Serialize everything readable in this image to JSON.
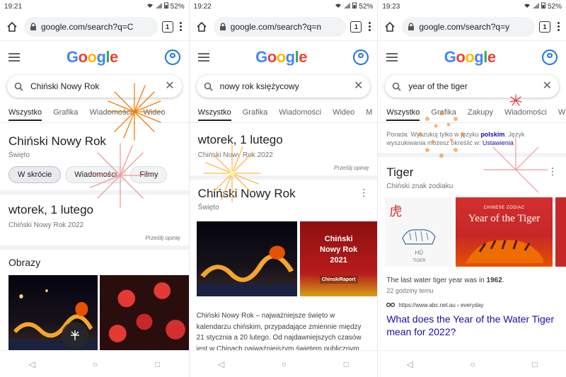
{
  "panels": [
    {
      "status": {
        "time": "19:21",
        "battery": "52%"
      },
      "browser": {
        "url": "google.com/search?q=C",
        "tab_count": "1"
      },
      "search": {
        "query": "Chiński Nowy Rok"
      },
      "tabs": [
        "Wszystko",
        "Grafika",
        "Wiadomości",
        "Wideo"
      ],
      "knowledge": {
        "title": "Chiński Nowy Rok",
        "subtitle": "Święto",
        "chips": [
          "W skrócie",
          "Wiadomości",
          "Filmy"
        ]
      },
      "date": {
        "title": "wtorek, 1 lutego",
        "subtitle": "Chiński Nowy Rok 2022"
      },
      "feedback": "Prześlij opinię",
      "images_heading": "Obrazy"
    },
    {
      "status": {
        "time": "19:22",
        "battery": "52%"
      },
      "browser": {
        "url": "google.com/search?q=n",
        "tab_count": "1"
      },
      "search": {
        "query": "nowy rok księżycowy"
      },
      "tabs": [
        "Wszystko",
        "Grafika",
        "Wiadomości",
        "Wideo",
        "M"
      ],
      "date": {
        "title": "wtorek, 1 lutego",
        "subtitle": "Chiński Nowy Rok 2022"
      },
      "feedback": "Prześlij opinię",
      "knowledge": {
        "title": "Chiński Nowy Rok",
        "subtitle": "Święto"
      },
      "image_card": {
        "line1": "Chiński",
        "line2": "Nowy Rok",
        "line3": "2021",
        "brand": "ChinskiRaport"
      },
      "description": "Chiński Nowy Rok – najważniejsze święto w kalendarzu chińskim, przypadające zmiennie między 21 stycznia a 20 lutego. Od najdawniejszych czasów jest w Chinach najważniejszym świętem publicznym"
    },
    {
      "status": {
        "time": "19:23",
        "battery": "52%"
      },
      "browser": {
        "url": "google.com/search?q=y",
        "tab_count": "1"
      },
      "search": {
        "query": "year of the tiger"
      },
      "tabs": [
        "Wszystko",
        "Grafika",
        "Zakupy",
        "Wiadomości",
        "W"
      ],
      "language_note": {
        "prefix": "Porada: Wyszukuj tylko w języku ",
        "lang": "polskim",
        "suffix": ". Język wyszukiwania możesz określić w: ",
        "link": "Ustawienia"
      },
      "knowledge": {
        "title": "Tiger",
        "subtitle": "Chiński znak zodiaku"
      },
      "tiger_card": {
        "glyph": "虎",
        "pinyin": "HǓ",
        "caption": "TIGER"
      },
      "yot_card": {
        "small": "CHINESE ZODIAC",
        "big": "Year of the Tiger"
      },
      "fact": {
        "prefix": "The last water tiger year was in ",
        "year": "1962",
        "suffix": "."
      },
      "fact_time": "22 godziny temu",
      "source": "https://www.abc.net.au › everyday",
      "result_title": "What does the Year of the Water Tiger mean for 2022?"
    }
  ],
  "google_logo": [
    "G",
    "o",
    "o",
    "g",
    "l",
    "e"
  ],
  "colors": {
    "link": "#1a0dab",
    "accent": "#1a73e8"
  },
  "nav": [
    "back-triangle",
    "home-circle",
    "recents-square"
  ]
}
